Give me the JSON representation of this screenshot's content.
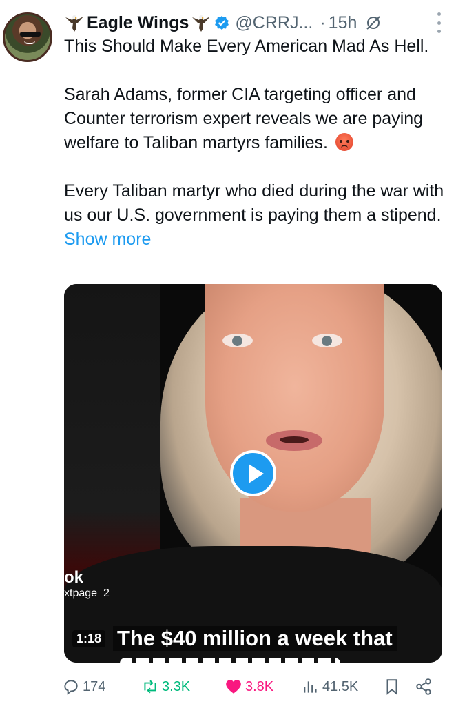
{
  "tweet": {
    "author_name": "Eagle Wings",
    "handle": "@CRRJ...",
    "separator": "·",
    "time": "15h",
    "paragraphs": [
      "This Should Make Every American Mad As Hell.",
      "Sarah Adams, former CIA targeting officer and Counter terrorism expert reveals we are paying welfare to Taliban martyrs families.",
      "Every Taliban martyr who died during the war with us our U.S. government is paying them a stipend."
    ],
    "show_more": "Show more"
  },
  "video": {
    "duration": "1:18",
    "caption": "The $40 million a week that",
    "watermark_title": "ok",
    "watermark_sub": "xtpage_2"
  },
  "actions": {
    "replies": "174",
    "reposts": "3.3K",
    "likes": "3.8K",
    "views": "41.5K"
  },
  "colors": {
    "accent": "#1d9bf0",
    "repost": "#00ba7c",
    "like": "#f91880",
    "secondary_text": "#536471"
  },
  "icons": [
    "eagle-icon",
    "verified-badge-icon",
    "grok-icon",
    "more-options-icon",
    "play-icon",
    "reply-icon",
    "repost-icon",
    "heart-icon",
    "views-icon",
    "bookmark-icon",
    "share-icon",
    "angry-face-emoji"
  ]
}
